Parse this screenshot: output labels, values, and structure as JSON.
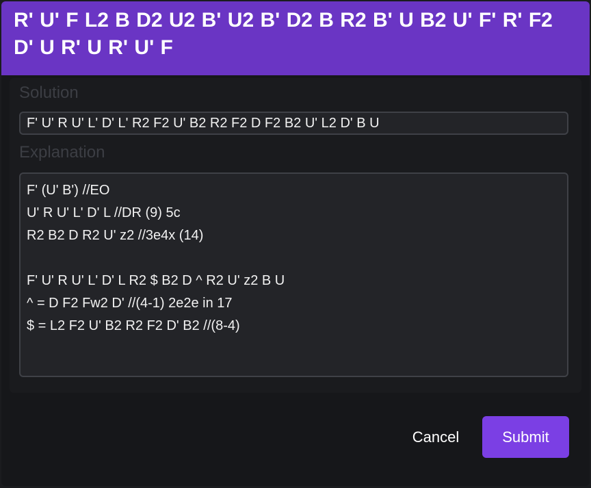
{
  "header": {
    "scramble": "R' U' F L2 B D2 U2 B' U2 B' D2 B R2 B' U B2 U' F' R' F2 D' U R' U R' U' F"
  },
  "form": {
    "solution_label": "Solution",
    "solution_value": "F' U' R U' L' D' L' R2 F2 U' B2 R2 F2 D F2 B2 U' L2 D' B U",
    "explanation_label": "Explanation",
    "explanation_value": "F' (U' B') //EO\nU' R U' L' D' L //DR (9) 5c\nR2 B2 D R2 U' z2 //3e4x (14)\n\nF' U' R U' L' D' L R2 $ B2 D ^ R2 U' z2 B U\n^ = D F2 Fw2 D' //(4-1) 2e2e in 17\n$ = L2 F2 U' B2 R2 F2 D' B2 //(8-4)"
  },
  "actions": {
    "cancel_label": "Cancel",
    "submit_label": "Submit"
  },
  "colors": {
    "header_bg": "#6a35c4",
    "submit_bg": "#7b3fe4",
    "dialog_bg": "#16171a"
  }
}
